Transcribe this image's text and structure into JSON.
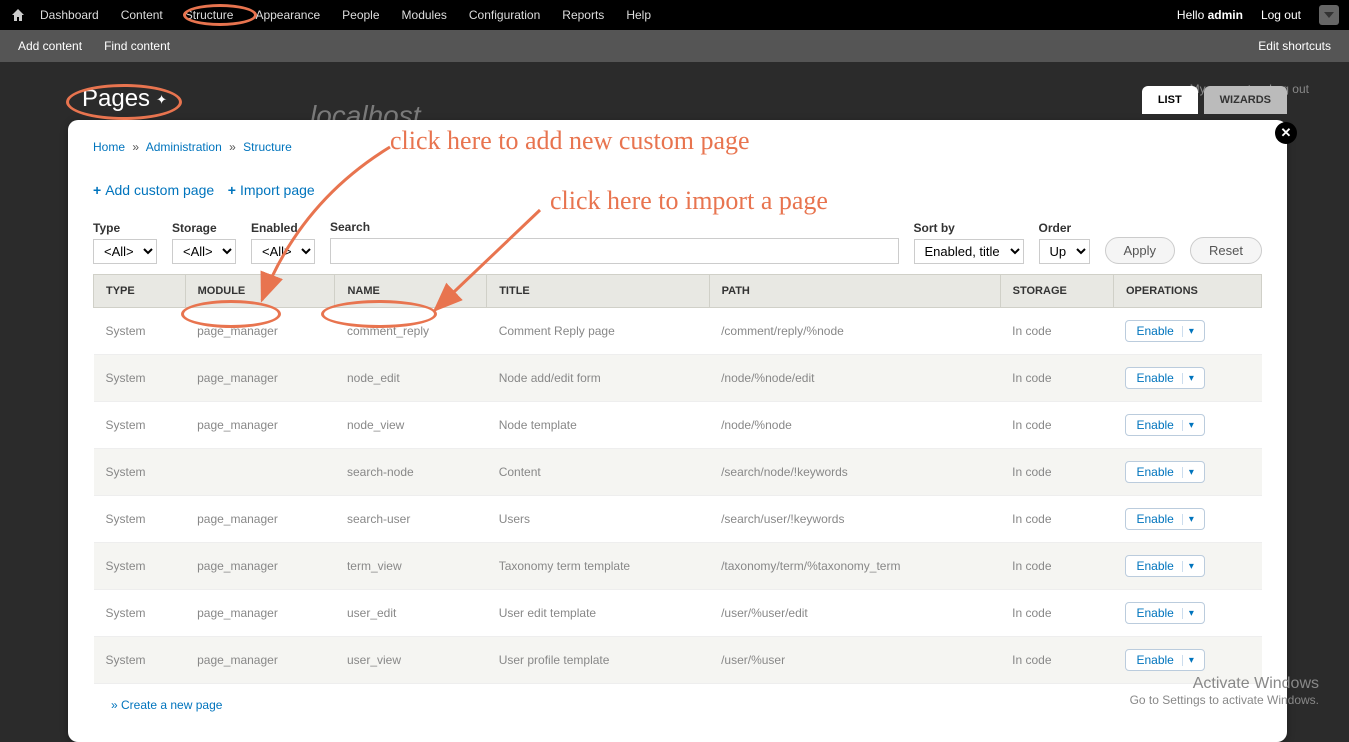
{
  "toolbar": {
    "menu": [
      "Dashboard",
      "Content",
      "Structure",
      "Appearance",
      "People",
      "Modules",
      "Configuration",
      "Reports",
      "Help"
    ],
    "hello": "Hello",
    "user": "admin",
    "logout": "Log out"
  },
  "toolbar2": {
    "add": "Add content",
    "find": "Find content",
    "edit": "Edit shortcuts"
  },
  "siteheader": {
    "sitename": "localhost",
    "myaccount": "My account",
    "logout": "Log out"
  },
  "page_title": "Pages",
  "tabs": {
    "list": "LIST",
    "wizards": "WIZARDS"
  },
  "breadcrumb": {
    "home": "Home",
    "admin": "Administration",
    "structure": "Structure"
  },
  "actions": {
    "add": "Add custom page",
    "import": "Import page"
  },
  "filters": {
    "type_label": "Type",
    "type_value": "<All>",
    "storage_label": "Storage",
    "storage_value": "<All>",
    "enabled_label": "Enabled",
    "enabled_value": "<All>",
    "search_label": "Search",
    "sortby_label": "Sort by",
    "sortby_value": "Enabled, title",
    "order_label": "Order",
    "order_value": "Up",
    "apply": "Apply",
    "reset": "Reset"
  },
  "columns": [
    "TYPE",
    "MODULE",
    "NAME",
    "TITLE",
    "PATH",
    "STORAGE",
    "OPERATIONS"
  ],
  "rows": [
    {
      "type": "System",
      "module": "page_manager",
      "name": "comment_reply",
      "title": "Comment Reply page",
      "path": "/comment/reply/%node",
      "storage": "In code",
      "op": "Enable"
    },
    {
      "type": "System",
      "module": "page_manager",
      "name": "node_edit",
      "title": "Node add/edit form",
      "path": "/node/%node/edit",
      "storage": "In code",
      "op": "Enable"
    },
    {
      "type": "System",
      "module": "page_manager",
      "name": "node_view",
      "title": "Node template",
      "path": "/node/%node",
      "storage": "In code",
      "op": "Enable"
    },
    {
      "type": "System",
      "module": "",
      "name": "search-node",
      "title": "Content",
      "path": "/search/node/!keywords",
      "storage": "In code",
      "op": "Enable"
    },
    {
      "type": "System",
      "module": "page_manager",
      "name": "search-user",
      "title": "Users",
      "path": "/search/user/!keywords",
      "storage": "In code",
      "op": "Enable"
    },
    {
      "type": "System",
      "module": "page_manager",
      "name": "term_view",
      "title": "Taxonomy term template",
      "path": "/taxonomy/term/%taxonomy_term",
      "storage": "In code",
      "op": "Enable"
    },
    {
      "type": "System",
      "module": "page_manager",
      "name": "user_edit",
      "title": "User edit template",
      "path": "/user/%user/edit",
      "storage": "In code",
      "op": "Enable"
    },
    {
      "type": "System",
      "module": "page_manager",
      "name": "user_view",
      "title": "User profile template",
      "path": "/user/%user",
      "storage": "In code",
      "op": "Enable"
    }
  ],
  "footer_link": "» Create a new page",
  "annotations": {
    "text1": "click here to add new custom page",
    "text2": "click here to import a page"
  },
  "activate": {
    "main": "Activate Windows",
    "sub": "Go to Settings to activate Windows."
  }
}
